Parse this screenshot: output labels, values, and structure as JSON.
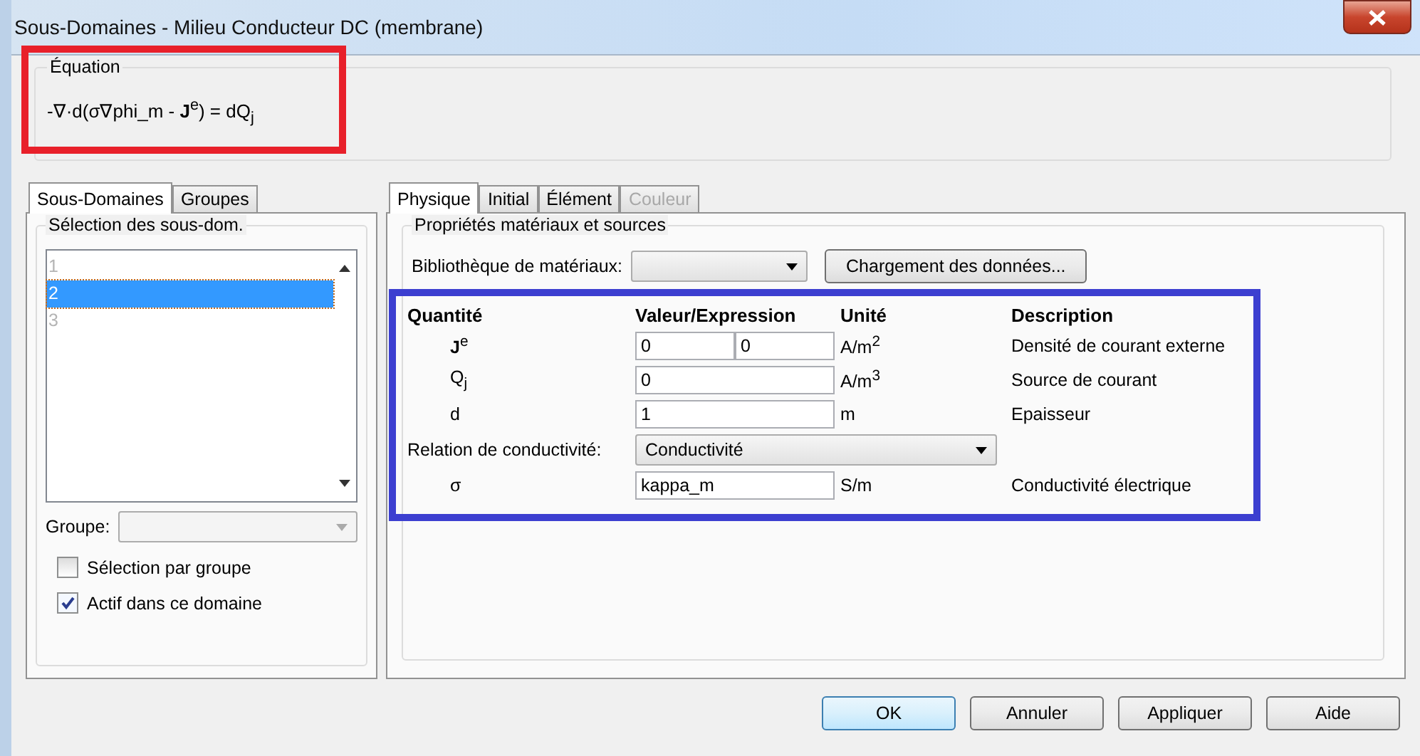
{
  "window": {
    "title": "Sous-Domaines - Milieu Conducteur DC (membrane)"
  },
  "equation": {
    "legend": "Équation",
    "formula": "-∇·d(σ∇phi_m - **J**$^{e}$) = dQ$_{j}$"
  },
  "left_tabs": [
    {
      "label": "Sous-Domaines",
      "selected": true
    },
    {
      "label": "Groupes",
      "selected": false
    }
  ],
  "subdomain_selection": {
    "legend": "Sélection des sous-dom.",
    "items": [
      {
        "label": "1",
        "selected": false
      },
      {
        "label": "2",
        "selected": true
      },
      {
        "label": "3",
        "selected": false
      }
    ],
    "group_label": "Groupe:",
    "checkboxes": [
      {
        "label": "Sélection par groupe",
        "checked": false
      },
      {
        "label": "Actif dans ce domaine",
        "checked": true
      }
    ]
  },
  "right_tabs": [
    {
      "label": "Physique",
      "selected": true,
      "disabled": false
    },
    {
      "label": "Initial",
      "selected": false,
      "disabled": false
    },
    {
      "label": "Élément",
      "selected": false,
      "disabled": false
    },
    {
      "label": "Couleur",
      "selected": false,
      "disabled": true
    }
  ],
  "properties": {
    "legend": "Propriétés matériaux et sources",
    "library_label": "Bibliothèque de matériaux:",
    "load_button": "Chargement des données...",
    "columns": [
      "Quantité",
      "Valeur/Expression",
      "Unité",
      "Description"
    ],
    "rows": [
      {
        "kind": "field",
        "quantity": "**J**$^{e}$",
        "values": [
          "0",
          "0"
        ],
        "unit": "A/m$^{2}$",
        "description": "Densité de courant externe"
      },
      {
        "kind": "field",
        "quantity": "Q$_{j}$",
        "values": [
          "0"
        ],
        "unit": "A/m$^{3}$",
        "description": "Source de courant"
      },
      {
        "kind": "field",
        "quantity": "d",
        "values": [
          "1"
        ],
        "unit": "m",
        "description": "Epaisseur"
      },
      {
        "kind": "select",
        "quantity": "Relation de conductivité:",
        "value": "Conductivité"
      },
      {
        "kind": "field",
        "quantity": "σ",
        "values": [
          "kappa_m"
        ],
        "unit": "S/m",
        "description": "Conductivité électrique"
      }
    ]
  },
  "buttons": [
    {
      "label": "OK",
      "default": true
    },
    {
      "label": "Annuler",
      "default": false
    },
    {
      "label": "Appliquer",
      "default": false
    },
    {
      "label": "Aide",
      "default": false
    }
  ]
}
